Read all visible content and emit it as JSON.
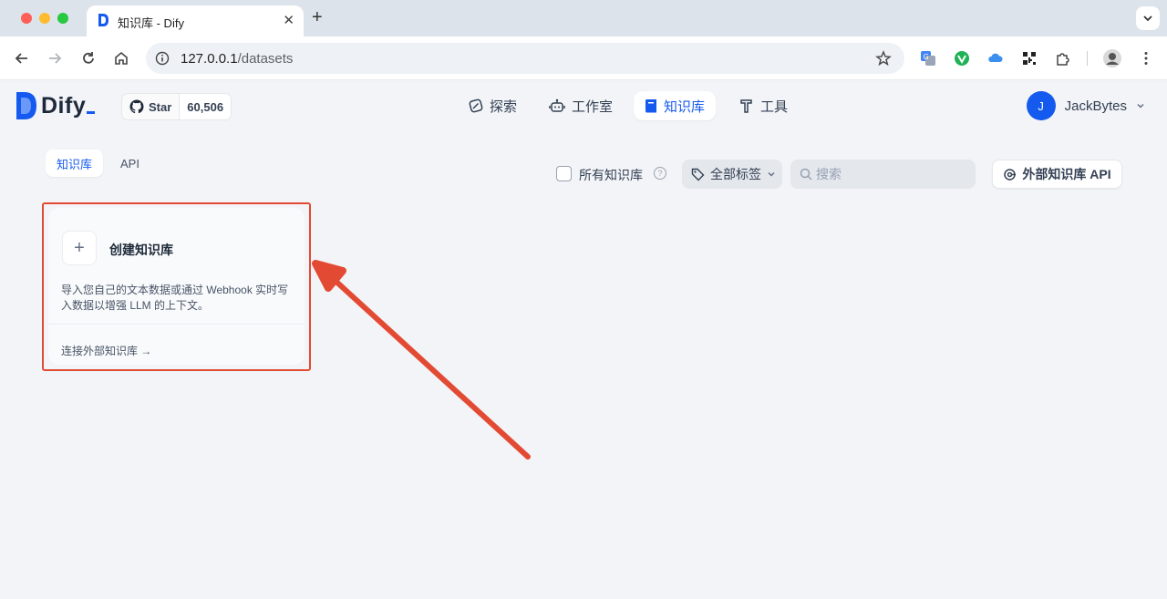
{
  "browser": {
    "tab_title": "知识库 - Dify",
    "url_host": "127.0.0.1",
    "url_path": "/datasets"
  },
  "header": {
    "logo_text": "Dify",
    "github_star_label": "Star",
    "github_star_count": "60,506",
    "nav": [
      {
        "label": "探索",
        "icon": "compass-icon",
        "active": false
      },
      {
        "label": "工作室",
        "icon": "robot-icon",
        "active": false
      },
      {
        "label": "知识库",
        "icon": "book-icon",
        "active": true
      },
      {
        "label": "工具",
        "icon": "hammer-icon",
        "active": false
      }
    ],
    "user_initial": "J",
    "user_name": "JackBytes"
  },
  "subtabs": [
    {
      "label": "知识库",
      "active": true
    },
    {
      "label": "API",
      "active": false
    }
  ],
  "filters": {
    "all_datasets_label": "所有知识库",
    "all_datasets_checked": false,
    "tag_filter_label": "全部标签",
    "search_placeholder": "搜索",
    "external_api_label": "外部知识库 API"
  },
  "create_card": {
    "title": "创建知识库",
    "description": "导入您自己的文本数据或通过 Webhook 实时写入数据以增强 LLM 的上下文。",
    "link": "连接外部知识库",
    "link_arrow": "→"
  },
  "annotation": {
    "highlight_color": "#e34a33"
  },
  "colors": {
    "accent": "#155aef",
    "background": "#f2f4f7"
  }
}
